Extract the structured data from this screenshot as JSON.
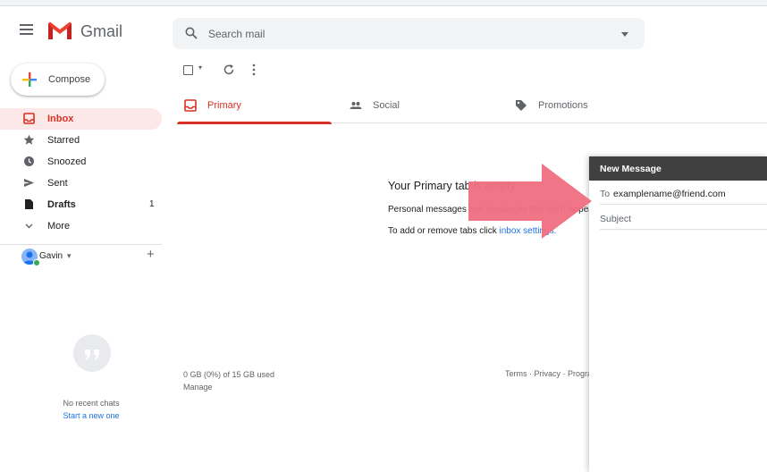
{
  "app": {
    "brand": "Gmail"
  },
  "search": {
    "placeholder": "Search mail"
  },
  "compose_button": {
    "label": "Compose"
  },
  "sidebar": {
    "items": [
      {
        "label": "Inbox",
        "count": ""
      },
      {
        "label": "Starred",
        "count": ""
      },
      {
        "label": "Snoozed",
        "count": ""
      },
      {
        "label": "Sent",
        "count": ""
      },
      {
        "label": "Drafts",
        "count": "1"
      },
      {
        "label": "More",
        "count": ""
      }
    ]
  },
  "hangouts": {
    "user_name": "Gavin",
    "no_chats": "No recent chats",
    "start_chat": "Start a new one"
  },
  "tabs": [
    {
      "label": "Primary"
    },
    {
      "label": "Social"
    },
    {
      "label": "Promotions"
    }
  ],
  "empty_state": {
    "title": "Your Primary tab is empty.",
    "subtitle": "Personal messages and messages that don't appear in other tabs will be shown here.",
    "tabs_hint_prefix": "To add or remove tabs click ",
    "tabs_hint_link": "inbox settings."
  },
  "footer": {
    "storage": "0 GB (0%) of 15 GB used",
    "manage": "Manage",
    "links": "Terms · Privacy · Program Policies"
  },
  "compose_window": {
    "title": "New Message",
    "to_label": "To",
    "to_value": "examplename@friend.com",
    "subject_label": "Subject"
  },
  "colors": {
    "accent_red": "#d93025",
    "link_blue": "#1a73e8",
    "annotation_arrow": "#ef6f82",
    "compose_header": "#404040"
  },
  "icons": {
    "menu": "hamburger-icon",
    "search": "search-icon",
    "inbox": "inbox-icon",
    "starred": "star-icon",
    "snoozed": "clock-icon",
    "sent": "send-icon",
    "drafts": "draft-icon",
    "more": "chevron-down-icon",
    "social": "people-icon",
    "promotions": "tag-icon",
    "refresh": "refresh-icon",
    "chat": "chat-bubble-icon"
  }
}
